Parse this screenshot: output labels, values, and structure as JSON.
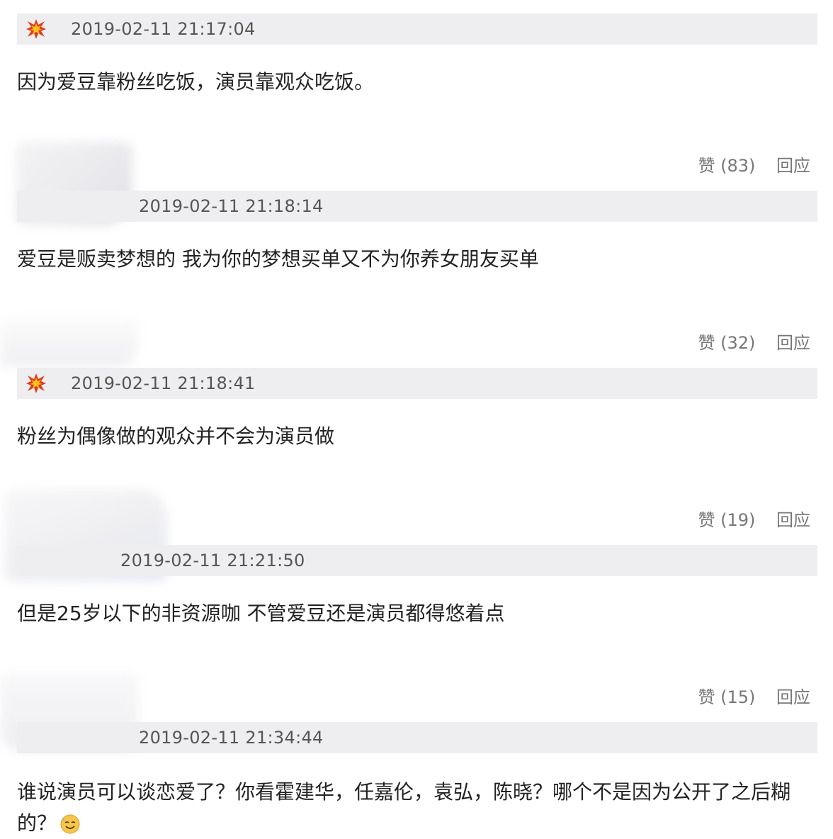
{
  "comments": [
    {
      "timestamp": "2019-02-11 21:17:04",
      "icon": "boom-icon",
      "text": "因为爱豆靠粉丝吃饭，演员靠观众吃饭。",
      "like_label": "赞 (83)",
      "reply_label": "回应"
    },
    {
      "timestamp": "2019-02-11 21:18:14",
      "text": "爱豆是贩卖梦想的 我为你的梦想买单又不为你养女朋友买单",
      "like_label": "赞 (32)",
      "reply_label": "回应"
    },
    {
      "timestamp": "2019-02-11 21:18:41",
      "icon": "boom-icon",
      "text": "粉丝为偶像做的观众并不会为演员做",
      "like_label": "赞 (19)",
      "reply_label": "回应"
    },
    {
      "timestamp": "2019-02-11 21:21:50",
      "text": "但是25岁以下的非资源咖 不管爱豆还是演员都得悠着点",
      "like_label": "赞 (15)",
      "reply_label": "回应"
    },
    {
      "timestamp": "2019-02-11 21:34:44",
      "text": "谁说演员可以谈恋爱了？你看霍建华，任嘉伦，袁弘，陈晓？哪个不是因为公开了之后糊的？",
      "emoji": "sweat-smile-emoji"
    }
  ],
  "colors": {
    "meta_bar": "#eeeef0",
    "timestamp": "#555555",
    "text": "#222222",
    "action": "#777777"
  }
}
